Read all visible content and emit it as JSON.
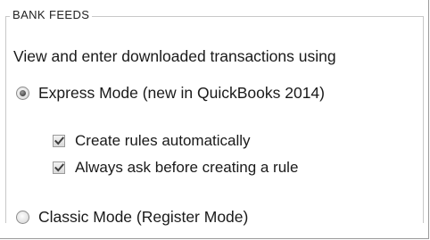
{
  "group": {
    "title": "BANK FEEDS"
  },
  "description": "View and enter downloaded transactions using",
  "options": {
    "express_mode": {
      "label": "Express Mode (new in QuickBooks 2014)",
      "selected": true,
      "icon": "radio-selected-icon"
    },
    "create_rules": {
      "label": "Create rules automatically",
      "checked": true,
      "icon": "checkmark-icon"
    },
    "ask_before_rule": {
      "label": "Always ask before creating a rule",
      "checked": true,
      "icon": "checkmark-icon"
    },
    "classic_mode": {
      "label": "Classic Mode (Register Mode)",
      "selected": false,
      "icon": "radio-unselected-icon"
    }
  },
  "colors": {
    "background": "#ffffff",
    "text": "#1a1a1a",
    "group_border": "#c8c8c8",
    "control_border": "#8c8c8c"
  }
}
